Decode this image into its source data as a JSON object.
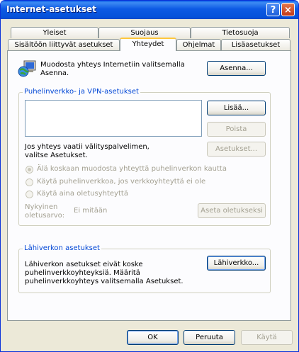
{
  "window": {
    "title": "Internet-asetukset",
    "help_glyph": "?",
    "close_glyph": "×"
  },
  "tabs_top": [
    "Yleiset",
    "Suojaus",
    "Tietosuoja"
  ],
  "tabs_bottom": [
    "Sisältöön liittyvät asetukset",
    "Yhteydet",
    "Ohjelmat",
    "Lisäasetukset"
  ],
  "active_tab": "Yhteydet",
  "setup": {
    "text": "Muodosta yhteys Internetiin valitsemalla Asenna.",
    "button": "Asenna..."
  },
  "vpn": {
    "legend": "Puhelinverkko- ja VPN-asetukset",
    "add_button": "Lisää...",
    "remove_button": "Poista",
    "settings_note": "Jos yhteys vaatii välityspalvelimen, valitse Asetukset.",
    "settings_button": "Asetukset...",
    "radios": [
      {
        "label": "Älä koskaan muodosta yhteyttä puhelinverkon kautta",
        "checked": true
      },
      {
        "label": "Käytä puhelinverkkoa, jos verkkoyhteyttä ei ole",
        "checked": false
      },
      {
        "label": "Käytä aina oletusyhteyttä",
        "checked": false
      }
    ],
    "current_default_label": "Nykyinen oletusarvo:",
    "current_default_value": "Ei mitään",
    "set_default_button": "Aseta oletukseksi"
  },
  "lan": {
    "legend": "Lähiverkon asetukset",
    "text": "Lähiverkon asetukset eivät koske puhelinverkkoyhteyksiä. Määritä puhelinverkkoyhteys valitsemalla Asetukset.",
    "button": "Lähiverkko..."
  },
  "footer": {
    "ok": "OK",
    "cancel": "Peruuta",
    "apply": "Käytä"
  }
}
